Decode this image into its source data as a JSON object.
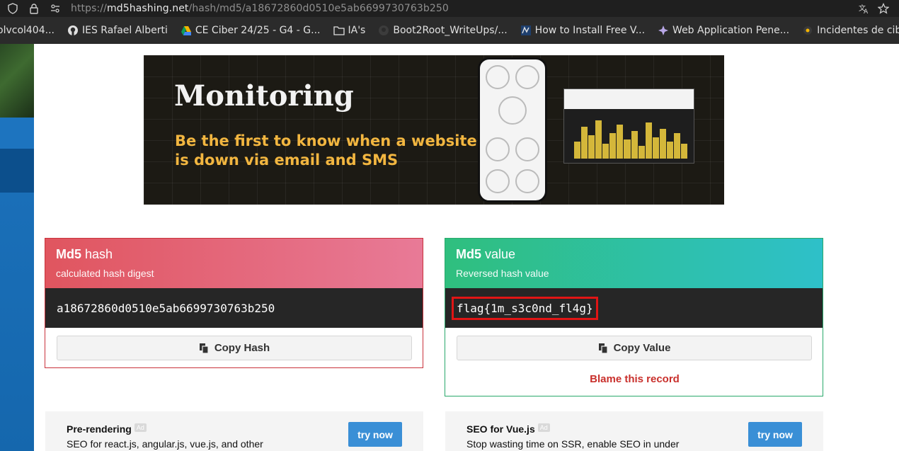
{
  "browser": {
    "url_prefix": "https://",
    "url_host": "md5hashing.net",
    "url_path": "/hash/md5/a18672860d0510e5ab6699730763b250"
  },
  "bookmarks": [
    {
      "label": "olvcol404...",
      "icon": "none"
    },
    {
      "label": "IES Rafael Alberti",
      "icon": "github-icon"
    },
    {
      "label": "CE Ciber 24/25 - G4 - G...",
      "icon": "drive-icon"
    },
    {
      "label": "IA's",
      "icon": "folder-icon"
    },
    {
      "label": "Boot2Root_WriteUps/...",
      "icon": "github-icon"
    },
    {
      "label": "How to Install Free V...",
      "icon": "site-icon"
    },
    {
      "label": "Web Application Pene...",
      "icon": "star-icon"
    },
    {
      "label": "Incidentes de ciberseg...",
      "icon": "dot-icon"
    }
  ],
  "banner": {
    "title": "Monitoring",
    "subtitle": "Be the first to know when a website is down via email and SMS"
  },
  "hash_card": {
    "title_bold": "Md5",
    "title_rest": " hash",
    "subtitle": "calculated hash digest",
    "value": "a18672860d0510e5ab6699730763b250",
    "button_label": "Copy Hash"
  },
  "value_card": {
    "title_bold": "Md5",
    "title_rest": " value",
    "subtitle": "Reversed hash value",
    "value": "flag{1m_s3c0nd_fl4g}",
    "button_label": "Copy Value",
    "blame_label": "Blame this record"
  },
  "ads": [
    {
      "title": "Pre-rendering",
      "badge": "Ad",
      "desc": "SEO for react.js, angular.js, vue.js, and other",
      "button": "try now"
    },
    {
      "title": "SEO for Vue.js",
      "badge": "Ad",
      "desc": "Stop wasting time on SSR, enable SEO in under",
      "button": "try now"
    }
  ],
  "colors": {
    "hash_accent": "#c9323b",
    "value_accent": "#29a96b",
    "highlight_box": "#e01515",
    "blame": "#c9302c",
    "try_button": "#3a8fd6"
  }
}
